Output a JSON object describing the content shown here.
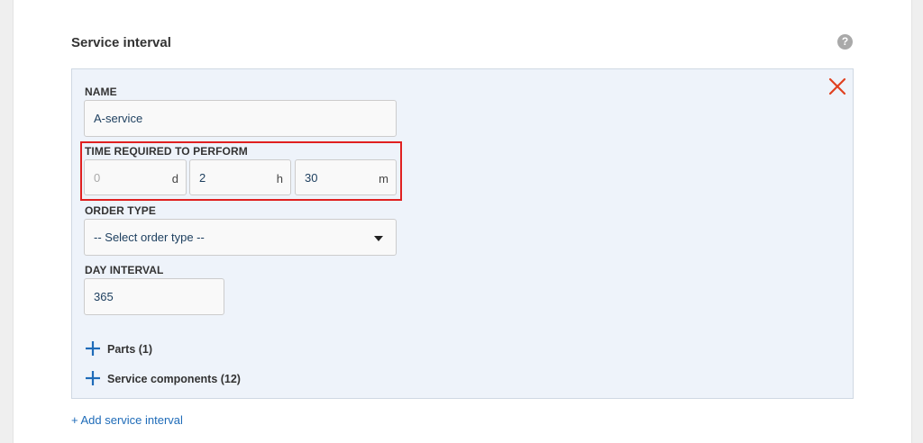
{
  "section": {
    "title": "Service interval",
    "help": "?"
  },
  "form": {
    "name_label": "NAME",
    "name_value": "A-service",
    "time_label": "TIME REQUIRED TO PERFORM",
    "time": {
      "days_placeholder": "0",
      "days_unit": "d",
      "hours_value": "2",
      "hours_unit": "h",
      "minutes_value": "30",
      "minutes_unit": "m"
    },
    "order_type_label": "ORDER TYPE",
    "order_type_value": "-- Select order type --",
    "day_interval_label": "DAY INTERVAL",
    "day_interval_value": "365"
  },
  "expanders": {
    "parts": "Parts (1)",
    "components": "Service components (12)"
  },
  "add_link": "+ Add service interval",
  "colors": {
    "accent": "#1e6bb8",
    "close": "#e0401f",
    "highlight": "#e02020",
    "panel_bg": "#eef3fa"
  }
}
